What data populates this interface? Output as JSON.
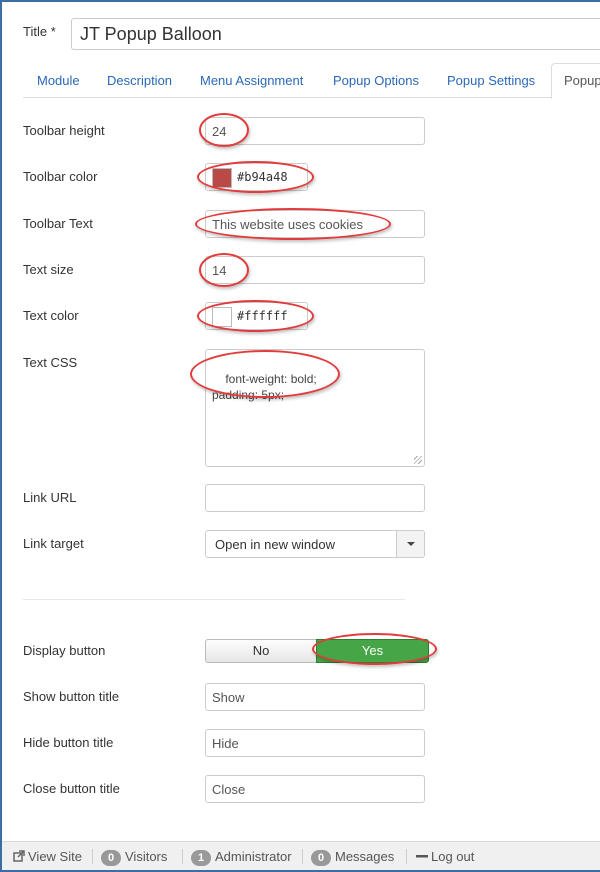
{
  "title": {
    "label": "Title *",
    "value": "JT Popup Balloon"
  },
  "tabs": [
    {
      "label": "Module"
    },
    {
      "label": "Description"
    },
    {
      "label": "Menu Assignment"
    },
    {
      "label": "Popup Options"
    },
    {
      "label": "Popup Settings"
    },
    {
      "label": "Popup"
    }
  ],
  "fields": {
    "toolbar_height": {
      "label": "Toolbar height",
      "value": "24"
    },
    "toolbar_color": {
      "label": "Toolbar color",
      "value": "#b94a48",
      "swatch": "#b94a48"
    },
    "toolbar_text": {
      "label": "Toolbar Text",
      "value": "This website uses cookies"
    },
    "text_size": {
      "label": "Text size",
      "value": "14"
    },
    "text_color": {
      "label": "Text color",
      "value": "#ffffff",
      "swatch": "#ffffff"
    },
    "text_css": {
      "label": "Text CSS",
      "value": "font-weight: bold;\npadding: 5px;"
    },
    "link_url": {
      "label": "Link URL",
      "value": ""
    },
    "link_target": {
      "label": "Link target",
      "value": "Open in new window"
    },
    "display_button": {
      "label": "Display button",
      "no_label": "No",
      "yes_label": "Yes",
      "selected": "Yes"
    },
    "show_button_title": {
      "label": "Show button title",
      "value": "Show"
    },
    "hide_button_title": {
      "label": "Hide button title",
      "value": "Hide"
    },
    "close_button_title": {
      "label": "Close button title",
      "value": "Close"
    }
  },
  "statusbar": {
    "view_site": "View Site",
    "visitors_count": "0",
    "visitors_label": "Visitors",
    "admin_count": "1",
    "admin_label": "Administrator",
    "messages_count": "0",
    "messages_label": "Messages",
    "logout": "Log out"
  },
  "colors": {
    "link": "#2a69b8",
    "toggle_yes": "#46a546",
    "annotation": "#e23b3b"
  }
}
